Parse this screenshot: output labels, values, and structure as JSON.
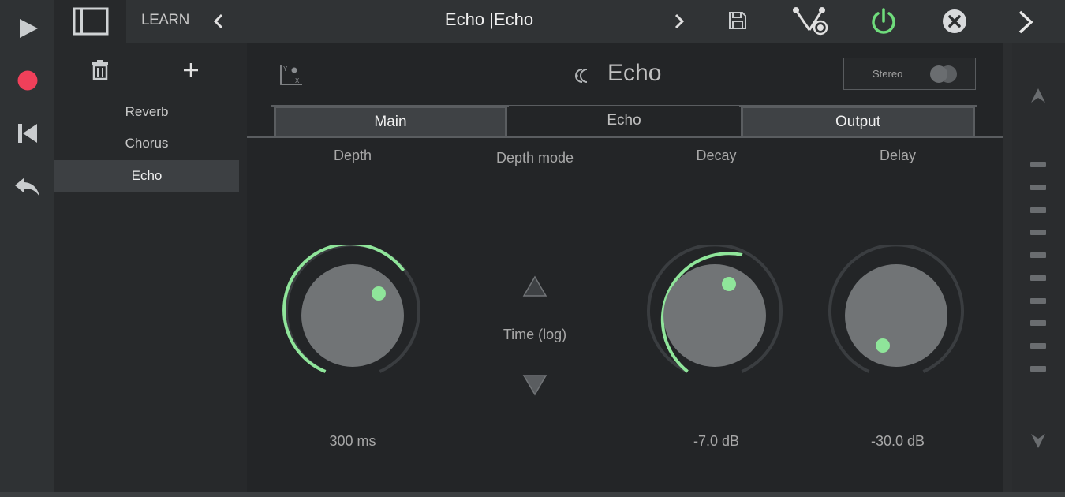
{
  "header": {
    "learn_label": "LEARN",
    "title_left": "Echo",
    "title_separator": "|",
    "title_right": "Echo"
  },
  "transport": {
    "icons": [
      "play-icon",
      "record-icon",
      "skip-back-icon",
      "undo-icon"
    ]
  },
  "sidebar": {
    "items": [
      {
        "label": "Reverb",
        "selected": false
      },
      {
        "label": "Chorus",
        "selected": false
      },
      {
        "label": "Echo",
        "selected": true
      }
    ]
  },
  "plugin": {
    "title": "Echo",
    "stereo_label": "Stereo",
    "stereo_on": false
  },
  "tabs": [
    {
      "label": "Main",
      "active": false
    },
    {
      "label": "Echo",
      "active": true
    },
    {
      "label": "Output",
      "active": false
    }
  ],
  "params": {
    "depth": {
      "label": "Depth",
      "value": "300 ms"
    },
    "depth_mode": {
      "label": "Depth mode",
      "value": "Time (log)"
    },
    "decay": {
      "label": "Decay",
      "value": "-7.0 dB"
    },
    "delay": {
      "label": "Delay",
      "value": "-30.0 dB"
    }
  },
  "colors": {
    "accent_green": "#8fe59a",
    "record_red": "#f0405a",
    "power_green": "#6fdc7c"
  }
}
